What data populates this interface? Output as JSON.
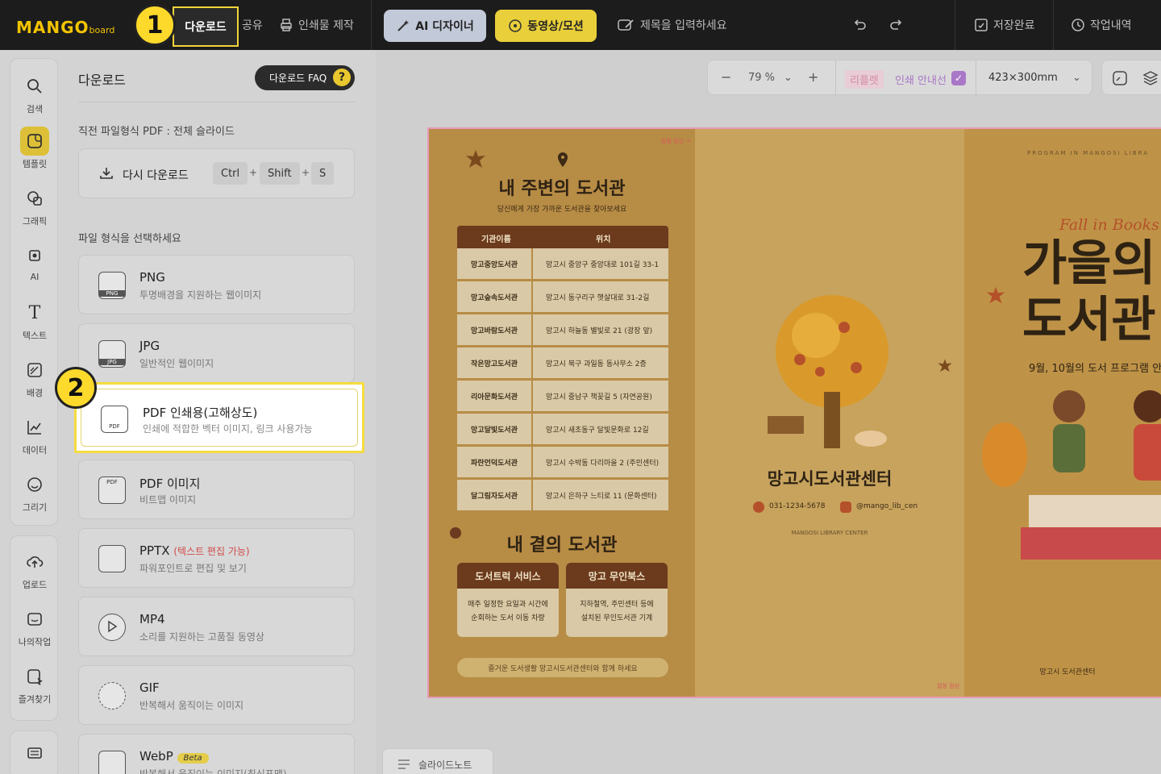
{
  "logo": {
    "main": "MANGO",
    "sub": "board"
  },
  "topbar": {
    "download": "다운로드",
    "share": "공유",
    "print": "인쇄물 제작",
    "ai_designer": "AI 디자이너",
    "video": "동영상/모션",
    "title_placeholder": "제목을 입력하세요",
    "saved": "저장완료",
    "history": "작업내역"
  },
  "badges": {
    "one": "1",
    "two": "2"
  },
  "rail": {
    "items": [
      "검색",
      "템플릿",
      "그래픽",
      "AI",
      "텍스트",
      "배경",
      "데이터",
      "그리기"
    ],
    "items2": [
      "업로드",
      "나의작업",
      "즐겨찾기"
    ]
  },
  "panel": {
    "title": "다운로드",
    "faq": "다운로드 FAQ",
    "faq_q": "?",
    "last_format": "직전 파일형식 PDF : 전체 슬라이드",
    "redownload": "다시 다운로드",
    "keys": [
      "Ctrl",
      "Shift",
      "S"
    ],
    "plus": "+",
    "choose_label": "파일 형식을 선택하세요",
    "formats": [
      {
        "name": "PNG",
        "desc": "투명배경을 지원하는 웹이미지",
        "tag": "PNG"
      },
      {
        "name": "JPG",
        "desc": "일반적인 웹이미지",
        "tag": "JPG"
      },
      {
        "name": "PDF 인쇄용(고해상도)",
        "desc": "인쇄에 적합한 벡터 이미지, 링크 사용가능",
        "tag": "PDF"
      },
      {
        "name": "PDF 이미지",
        "desc": "비트맵 이미지",
        "tag": "PDF"
      },
      {
        "name": "PPTX",
        "extra": "(텍스트 편집 가능)",
        "desc": "파워포인트로 편집 및 보기"
      },
      {
        "name": "MP4",
        "desc": "소리를 지원하는 고품질 동영상"
      },
      {
        "name": "GIF",
        "desc": "반복해서 움직이는 이미지"
      },
      {
        "name": "WebP",
        "beta": "Beta",
        "desc": "반복해서 움직이는 이미지(최신포맷)"
      }
    ]
  },
  "zoom": {
    "minus": "−",
    "value": "79 %",
    "plus": "+",
    "leaflet": "리플렛",
    "print_guide": "인쇄 안내선",
    "size": "423×300mm"
  },
  "doc": {
    "fold_mark": "접힘 점선 →",
    "heading1": "내 주변의 도서관",
    "sub1": "당신에게 가장 가까운 도서관을 찾아보세요",
    "table_head": [
      "기관이름",
      "위치"
    ],
    "rows": [
      [
        "망고중앙도서관",
        "망고시 중앙구 중앙대로 101길 33-1"
      ],
      [
        "망고숲속도서관",
        "망고시 동구리구 햇살대로 31-2길"
      ],
      [
        "망고바람도서관",
        "망고시 하늘동 별빛로 21 (광장 앞)"
      ],
      [
        "작은망고도서관",
        "망고시 북구 과일동 동사무소 2층"
      ],
      [
        "리아문화도서관",
        "망고시 중남구 책꽂길 5 (자연공원)"
      ],
      [
        "망고달빛도서관",
        "망고시 새초동구 달빛문화로 12길"
      ],
      [
        "파란언덕도서관",
        "망고시 수박동 다리마을 2 (주민센터)"
      ],
      [
        "달그림자도서관",
        "망고시 은하구 느티로 11 (문화센터)"
      ]
    ],
    "heading2": "내 곁의 도서관",
    "services": [
      {
        "title": "도서트럭 서비스",
        "desc1": "매주 일정한 요일과 시간에",
        "desc2": "순회하는 도서 이동 차량"
      },
      {
        "title": "망고 무인북스",
        "desc1": "지하철역, 주민센터 등에",
        "desc2": "설치된 무인도서관 기계"
      }
    ],
    "note": "즐거운 도서생활 망고시도서관센터와 함께 하세요",
    "center_name": "망고시도서관센터",
    "phone": "031-1234-5678",
    "sns": "@mango_lib_cen",
    "center_en": "MANGOSI LIBRARY CENTER",
    "fold_mark2": "접힘 점선",
    "program": "PROGRAM IN MANGOSI LIBRA",
    "fall": "Fall in Books",
    "big1": "가을의",
    "big2": "도서관",
    "months": "9월, 10월의 도서 프로그램 안",
    "footer3": "망고시 도서관센터"
  },
  "slide_note": "슬라이드노트",
  "colors": {
    "accent": "#f2c400",
    "highlight": "#f5dc3f",
    "topbar": "#1c1c1c",
    "brown": "#6c3a1c"
  }
}
